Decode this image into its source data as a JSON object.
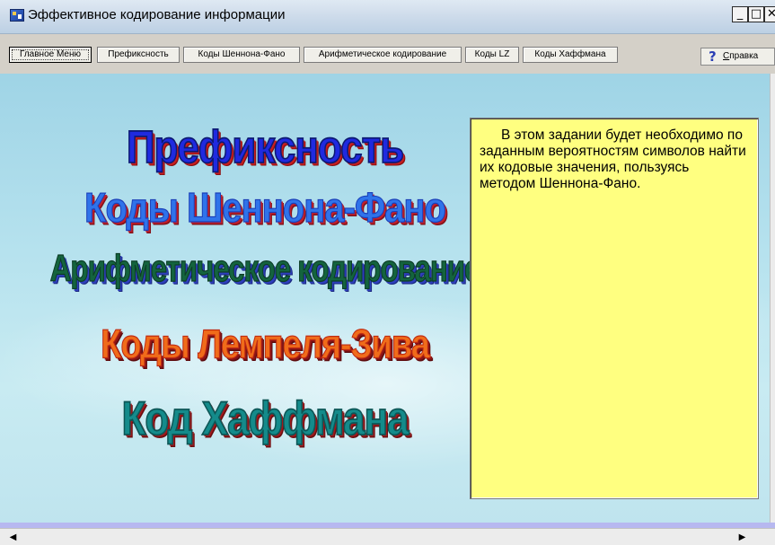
{
  "window": {
    "title": "Эффективное кодирование информации",
    "min_glyph": "_",
    "max_glyph": "□",
    "close_glyph": "✕"
  },
  "toolbar": {
    "tabs": [
      {
        "label": "Главное Меню",
        "active": true
      },
      {
        "label": "Префиксность",
        "active": false
      },
      {
        "label": "Коды Шеннона-Фано",
        "active": false
      },
      {
        "label": "Арифметическое кодирование",
        "active": false
      },
      {
        "label": "Коды LZ",
        "active": false
      },
      {
        "label": "Коды Хаффмана",
        "active": false
      }
    ],
    "help": {
      "icon": "question-mark-icon",
      "glyph": "?",
      "label_first": "С",
      "label_rest": "правка"
    }
  },
  "menu": {
    "links": [
      "Префиксность",
      "Коды Шеннона-Фано",
      "Арифметическое кодирование",
      "Коды Лемпеля-Зива",
      "Код Хаффмана"
    ]
  },
  "info": {
    "text": "В этом задании будет необходимо по заданным вероятностям символов найти их кодовые значения, пользуясь методом Шеннона-Фано."
  },
  "scrollbar": {
    "left_glyph": "◀",
    "right_glyph": "▶"
  },
  "colors": {
    "sky": "#b6e2ee",
    "info_background": "#ffff80",
    "bottom_band": "#b7b8f0"
  }
}
